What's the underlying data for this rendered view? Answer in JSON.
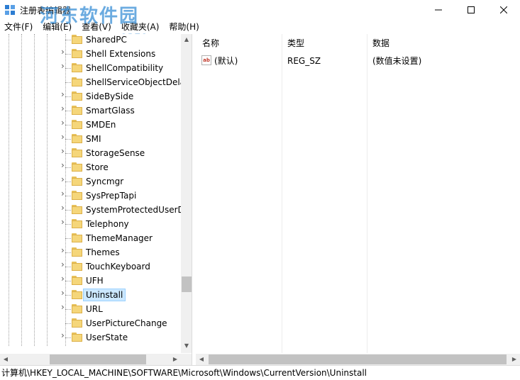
{
  "window": {
    "title": "注册表编辑器",
    "watermark": "河东软件园",
    "watermark_url": "www.pc0359.cn"
  },
  "menu": [
    "文件(F)",
    "编辑(E)",
    "查看(V)",
    "收藏夹(A)",
    "帮助(H)"
  ],
  "tree": {
    "selected": "Uninstall",
    "items": [
      {
        "label": "SharedPC",
        "expandable": false
      },
      {
        "label": "Shell Extensions",
        "expandable": true
      },
      {
        "label": "ShellCompatibility",
        "expandable": true
      },
      {
        "label": "ShellServiceObjectDela",
        "expandable": false
      },
      {
        "label": "SideBySide",
        "expandable": true
      },
      {
        "label": "SmartGlass",
        "expandable": true
      },
      {
        "label": "SMDEn",
        "expandable": true
      },
      {
        "label": "SMI",
        "expandable": true
      },
      {
        "label": "StorageSense",
        "expandable": true
      },
      {
        "label": "Store",
        "expandable": true
      },
      {
        "label": "Syncmgr",
        "expandable": true
      },
      {
        "label": "SysPrepTapi",
        "expandable": true
      },
      {
        "label": "SystemProtectedUserD",
        "expandable": true
      },
      {
        "label": "Telephony",
        "expandable": true
      },
      {
        "label": "ThemeManager",
        "expandable": false
      },
      {
        "label": "Themes",
        "expandable": true
      },
      {
        "label": "TouchKeyboard",
        "expandable": true
      },
      {
        "label": "UFH",
        "expandable": true
      },
      {
        "label": "Uninstall",
        "expandable": true
      },
      {
        "label": "URL",
        "expandable": true
      },
      {
        "label": "UserPictureChange",
        "expandable": false
      },
      {
        "label": "UserState",
        "expandable": true
      }
    ]
  },
  "list": {
    "columns": [
      "名称",
      "类型",
      "数据"
    ],
    "rows": [
      {
        "name": "(默认)",
        "type": "REG_SZ",
        "data": "(数值未设置)",
        "icon": "string-value-icon"
      }
    ]
  },
  "status": {
    "path": "计算机\\HKEY_LOCAL_MACHINE\\SOFTWARE\\Microsoft\\Windows\\CurrentVersion\\Uninstall"
  },
  "colors": {
    "selection": "#cce8ff",
    "folder": "#f5d67a",
    "watermark": "#3a8fd6"
  }
}
